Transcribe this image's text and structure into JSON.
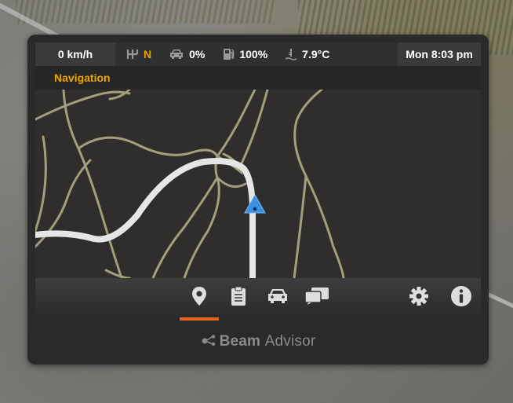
{
  "status": {
    "speed": "0 km/h",
    "gear": "N",
    "damage": "0%",
    "fuel": "100%",
    "temperature": "7.9°C",
    "time": "Mon 8:03 pm"
  },
  "app": {
    "title": "Navigation"
  },
  "toolbar": {
    "buttons": [
      {
        "name": "navigation",
        "icon": "map-pin-icon",
        "active": true
      },
      {
        "name": "notes",
        "icon": "clipboard-icon",
        "active": false
      },
      {
        "name": "vehicle",
        "icon": "car-icon",
        "active": false
      },
      {
        "name": "messages",
        "icon": "chat-icon",
        "active": false
      },
      {
        "name": "settings",
        "icon": "gear-icon",
        "active": false
      },
      {
        "name": "info",
        "icon": "info-icon",
        "active": false
      }
    ]
  },
  "brand": {
    "name_bold": "Beam",
    "name_light": "Advisor"
  },
  "colors": {
    "accent": "#f0a500",
    "active_tab": "#e8641b",
    "route": "#e6e6e6",
    "map_roads": "#a29f7c",
    "player_marker": "#3b8fe0"
  }
}
